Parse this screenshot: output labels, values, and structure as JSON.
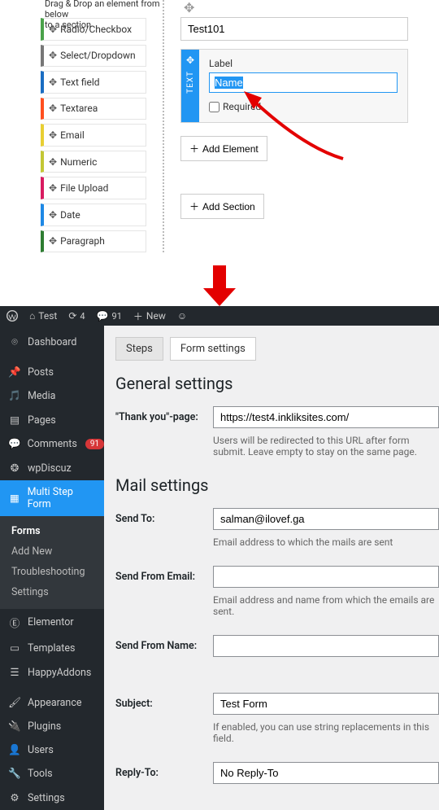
{
  "builder": {
    "hint_line1": "Drag & Drop an element from below",
    "hint_line2": "to a section",
    "palette": [
      {
        "label": "Radio/Checkbox",
        "cls": "b-radio"
      },
      {
        "label": "Select/Dropdown",
        "cls": "b-select"
      },
      {
        "label": "Text field",
        "cls": "b-text"
      },
      {
        "label": "Textarea",
        "cls": "b-textarea"
      },
      {
        "label": "Email",
        "cls": "b-email"
      },
      {
        "label": "Numeric",
        "cls": "b-numeric"
      },
      {
        "label": "File Upload",
        "cls": "b-file"
      },
      {
        "label": "Date",
        "cls": "b-date"
      },
      {
        "label": "Paragraph",
        "cls": "b-para"
      }
    ],
    "section_title_value": "Test101",
    "field": {
      "handle_text": "TEXT",
      "label_caption": "Label",
      "label_value": "Name",
      "required_caption": "Required"
    },
    "add_element": "Add Element",
    "add_section": "Add Section"
  },
  "wp": {
    "toolbar": {
      "site_name": "Test",
      "update_count": "4",
      "comment_count": "91",
      "new_label": "New"
    },
    "menu": {
      "dashboard": "Dashboard",
      "posts": "Posts",
      "media": "Media",
      "pages": "Pages",
      "comments": "Comments",
      "comments_badge": "91",
      "wpdiscuz": "wpDiscuz",
      "multistep": "Multi Step Form",
      "sub": {
        "forms": "Forms",
        "addnew": "Add New",
        "trouble": "Troubleshooting",
        "settings": "Settings"
      },
      "elementor": "Elementor",
      "templates": "Templates",
      "happyaddons": "HappyAddons",
      "appearance": "Appearance",
      "plugins": "Plugins",
      "users": "Users",
      "tools": "Tools",
      "settingsm": "Settings"
    },
    "tabs": {
      "steps": "Steps",
      "form_settings": "Form settings"
    },
    "general": {
      "heading": "General settings",
      "thankyou_label": "\"Thank you\"-page:",
      "thankyou_value": "https://test4.inkliksites.com/",
      "thankyou_help": "Users will be redirected to this URL after form submit. Leave empty to stay on the same page."
    },
    "mail": {
      "heading": "Mail settings",
      "sendto_label": "Send To:",
      "sendto_value": "salman@ilovef.ga",
      "sendto_help": "Email address to which the mails are sent",
      "sendfromemail_label": "Send From Email:",
      "sendfromemail_value": "",
      "sendfromemail_help": "Email address and name from which the emails are sent.",
      "sendfromname_label": "Send From Name:",
      "sendfromname_value": "",
      "subject_label": "Subject:",
      "subject_value": "Test Form",
      "subject_help": "If enabled, you can use string replacements in this field.",
      "replyto_label": "Reply-To:",
      "replyto_value": "No Reply-To"
    }
  }
}
